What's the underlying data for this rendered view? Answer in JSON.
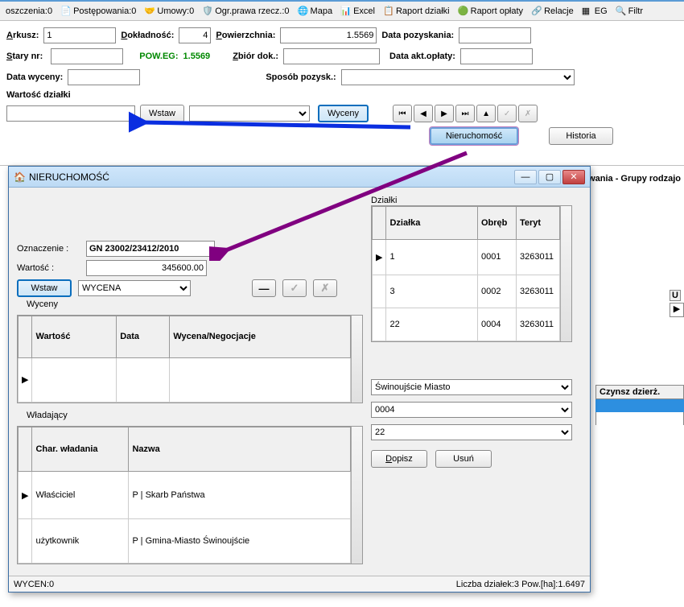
{
  "toolbar": {
    "items": [
      {
        "text": "oszczenia:0"
      },
      {
        "text": "Postępowania:0"
      },
      {
        "text": "Umowy:0"
      },
      {
        "text": "Ogr.prawa rzecz.:0"
      },
      {
        "text": "Mapa"
      },
      {
        "text": "Excel"
      },
      {
        "text": "Raport działki"
      },
      {
        "text": "Raport opłaty"
      },
      {
        "text": "Relacje"
      },
      {
        "text": "EG"
      },
      {
        "text": "Filtr"
      }
    ]
  },
  "form": {
    "arkusz_label": "Arkusz:",
    "arkusz_value": "1",
    "dokladnosc_label": "Dokładność:",
    "dokladnosc_value": "4",
    "powierzchnia_label": "Powierzchnia:",
    "powierzchnia_value": "1.5569",
    "data_pozyskania_label": "Data pozyskania:",
    "data_pozyskania_value": "",
    "stary_nr_label": "Stary nr:",
    "stary_nr_value": "",
    "pow_eg_label": "POW.EG:",
    "pow_eg_value": "1.5569",
    "zbior_dok_label": "Zbiór dok.:",
    "zbior_dok_value": "",
    "data_akt_label": "Data akt.opłaty:",
    "data_akt_value": "",
    "data_wyceny_label": "Data wyceny:",
    "data_wyceny_value": "",
    "sposob_pozysk_label": "Sposób pozysk.:",
    "wartosc_dzialki_label": "Wartość działki",
    "wstaw_btn": "Wstaw",
    "wyceny_btn": "Wyceny",
    "nieruchomosc_btn": "Nieruchomość",
    "historia_btn": "Historia"
  },
  "right_header": "wania - Grupy rodzajo",
  "right_u_label": "U",
  "czynsz_label": "Czynsz dzierż.",
  "dialog": {
    "title": "NIERUCHOMOŚĆ",
    "oznaczenie_label": "Oznaczenie :",
    "oznaczenie_value": "GN 23002/23412/2010",
    "wartosc_label": "Wartość :",
    "wartosc_value": "345600.00",
    "wstaw_btn": "Wstaw",
    "combo_value": "WYCENA",
    "wyceny_panel": "Wyceny",
    "wyceny_headers": {
      "wartosc": "Wartość",
      "data": "Data",
      "wyn": "Wycena/Negocjacje"
    },
    "wladajacy_panel": "Władający",
    "wladajacy_headers": {
      "char": "Char. władania",
      "nazwa": "Nazwa"
    },
    "wladajacy_rows": [
      {
        "char": "Właściciel",
        "nazwa": "P | Skarb Państwa"
      },
      {
        "char": "użytkownik",
        "nazwa": "P | Gmina-Miasto Świnoujście"
      }
    ],
    "dzialki_panel": "Działki",
    "dzialki_headers": {
      "dzialka": "Działka",
      "obreb": "Obręb",
      "teryt": "Teryt"
    },
    "dzialki_rows": [
      {
        "dzialka": "1",
        "obreb": "0001",
        "teryt": "3263011"
      },
      {
        "dzialka": "3",
        "obreb": "0002",
        "teryt": "3263011"
      },
      {
        "dzialka": "22",
        "obreb": "0004",
        "teryt": "3263011"
      }
    ],
    "combo1": "Świnoujście Miasto",
    "combo2": "0004",
    "combo3": "22",
    "dopisz_btn": "Dopisz",
    "usun_btn": "Usuń",
    "status_left": "WYCEN:0",
    "status_right": "Liczba działek:3  Pow.[ha]:1.6497"
  }
}
